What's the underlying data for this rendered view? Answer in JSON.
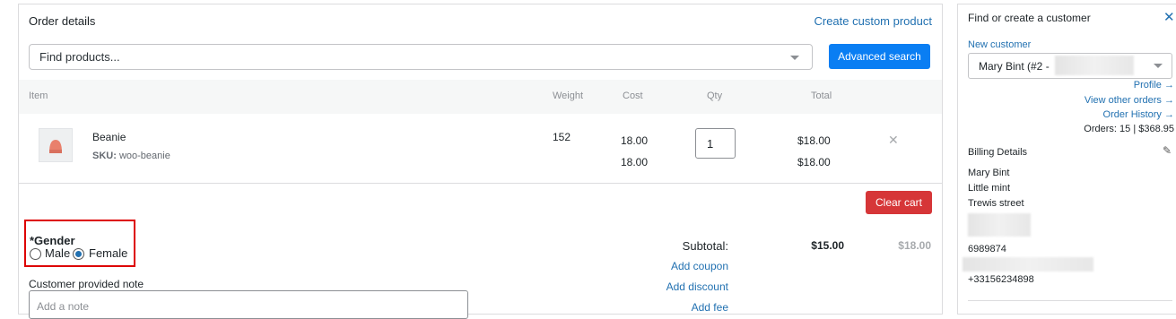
{
  "order": {
    "title": "Order details",
    "create_custom_product": "Create custom product",
    "search_placeholder": "Find products...",
    "advanced_search": "Advanced search",
    "columns": {
      "item": "Item",
      "weight": "Weight",
      "cost": "Cost",
      "qty": "Qty",
      "total": "Total"
    },
    "line_item": {
      "name": "Beanie",
      "sku_label": "SKU:",
      "sku": "woo-beanie",
      "weight": "152",
      "cost": "18.00",
      "cost_original": "18.00",
      "qty": "1",
      "total": "$18.00",
      "total_original": "$18.00",
      "remove_icon": "times-icon"
    },
    "clear_cart": "Clear cart",
    "gender": {
      "label": "*Gender",
      "options": [
        "Male",
        "Female"
      ],
      "selected": "Female"
    },
    "note_label": "Customer provided note",
    "note_placeholder": "Add a note",
    "totals": {
      "subtotal_label": "Subtotal:",
      "subtotal": "$15.00",
      "subtotal_original": "$18.00",
      "add_coupon": "Add coupon",
      "add_discount": "Add discount",
      "add_fee": "Add fee"
    }
  },
  "customer": {
    "title": "Find or create a customer",
    "close_icon": "close-icon",
    "new_customer": "New customer",
    "selected": "Mary Bint (#2 -",
    "profile": "Profile →",
    "view_other_orders": "View other orders →",
    "order_history": "Order History →",
    "orders_summary": "Orders: 15 | $368.95",
    "billing_title": "Billing Details",
    "billing": {
      "name": "Mary Bint",
      "company": "Little mint",
      "street": "Trewis street",
      "postcode": "6989874",
      "phone": "+33156234898"
    }
  },
  "colors": {
    "primary": "#0a7ef3",
    "link": "#2271b1",
    "danger": "#d63638",
    "highlight": "#dd0000"
  }
}
